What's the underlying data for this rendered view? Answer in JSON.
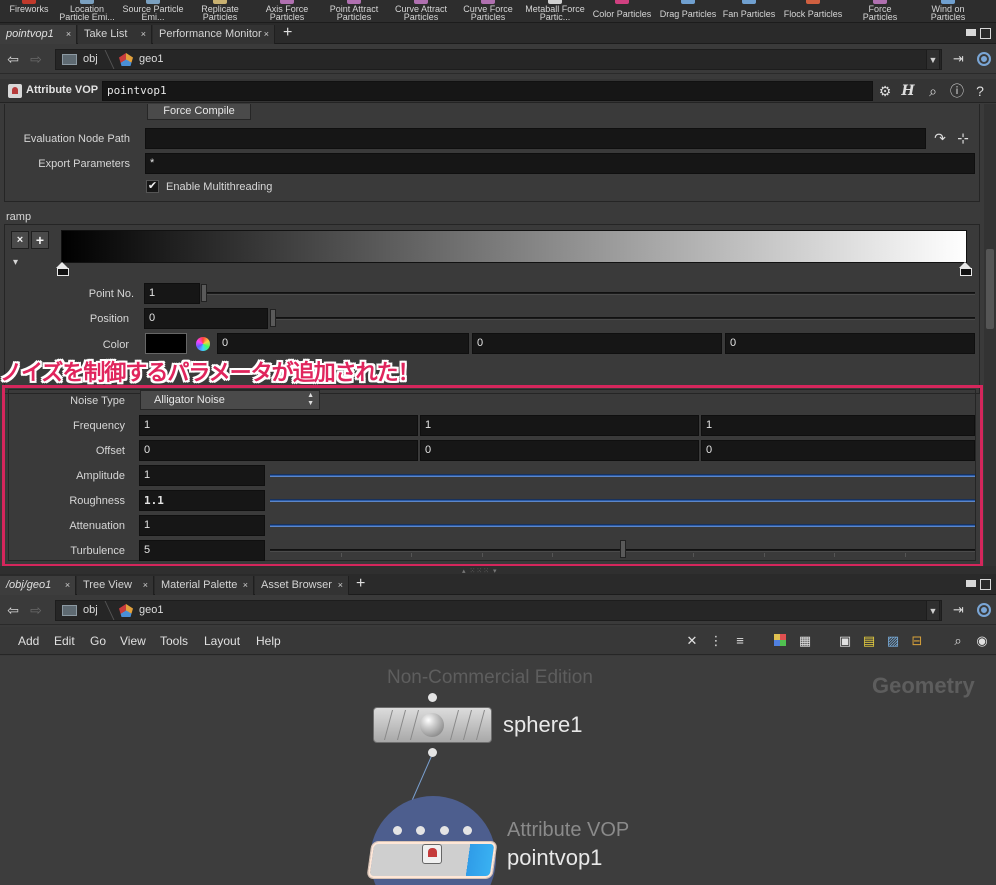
{
  "shelf": {
    "tools": [
      {
        "label": "Fireworks",
        "color": "#c0392b"
      },
      {
        "label": "Location Particle Emi...",
        "color": "#7aa0c0"
      },
      {
        "label": "Source Particle Emi...",
        "color": "#7aa0c0"
      },
      {
        "label": "Replicate Particles",
        "color": "#c8b070"
      },
      {
        "label": "Axis Force Particles",
        "color": "#b070b0"
      },
      {
        "label": "Point Attract Particles",
        "color": "#b070b0"
      },
      {
        "label": "Curve Attract Particles",
        "color": "#b070b0"
      },
      {
        "label": "Curve Force Particles",
        "color": "#b070b0"
      },
      {
        "label": "Metaball Force Partic...",
        "color": "#d0d0d0"
      },
      {
        "label": "Color Particles",
        "color": "#d04080"
      },
      {
        "label": "Drag Particles",
        "color": "#70a0d0"
      },
      {
        "label": "Fan Particles",
        "color": "#70a0d0"
      },
      {
        "label": "Flock Particles",
        "color": "#d06040"
      },
      {
        "label": "Force Particles",
        "color": "#b070b0"
      },
      {
        "label": "Wind on Particles",
        "color": "#70a0d0"
      }
    ]
  },
  "top_pane": {
    "tabs": [
      {
        "label": "pointvop1"
      },
      {
        "label": "Take List"
      },
      {
        "label": "Performance Monitor"
      }
    ],
    "close_glyph": "×",
    "plus_glyph": "+",
    "path": {
      "root": "obj",
      "node": "geo1"
    }
  },
  "params": {
    "node_type": "Attribute VOP",
    "node_name": "pointvop1",
    "force_compile_label": "Force Compile",
    "evaluation_node_path_label": "Evaluation Node Path",
    "evaluation_node_path_value": "",
    "export_parameters_label": "Export Parameters",
    "export_parameters_value": "*",
    "enable_multithreading_label": "Enable Multithreading",
    "enable_multithreading_checked": true,
    "check_glyph": "✔",
    "ramp_label": "ramp",
    "ramp_remove_glyph": "×",
    "ramp_add_glyph": "+",
    "ramp_menu_glyph": "▾",
    "point_no_label": "Point No.",
    "point_no_value": "1",
    "position_label": "Position",
    "position_value": "0",
    "color_label": "Color",
    "color_values": [
      "0",
      "0",
      "0"
    ],
    "noise_type_label": "Noise Type",
    "noise_type_value": "Alligator Noise",
    "frequency_label": "Frequency",
    "frequency_values": [
      "1",
      "1",
      "1"
    ],
    "offset_label": "Offset",
    "offset_values": [
      "0",
      "0",
      "0"
    ],
    "amplitude_label": "Amplitude",
    "amplitude_value": "1",
    "roughness_label": "Roughness",
    "roughness_value": "1.1",
    "attenuation_label": "Attenuation",
    "attenuation_value": "1",
    "turbulence_label": "Turbulence",
    "turbulence_value": "5",
    "turbulence_slider_fraction": 0.5
  },
  "annotation": {
    "text": "ノイズを制御するパラメータが追加された！",
    "color": "#e0255d"
  },
  "bottom_pane": {
    "tabs": [
      {
        "label": "/obj/geo1"
      },
      {
        "label": "Tree View"
      },
      {
        "label": "Material Palette"
      },
      {
        "label": "Asset Browser"
      }
    ],
    "path": {
      "root": "obj",
      "node": "geo1"
    },
    "menu": [
      "Add",
      "Edit",
      "Go",
      "View",
      "Tools",
      "Layout",
      "Help"
    ]
  },
  "network": {
    "watermark": "Non-Commercial Edition",
    "context_label": "Geometry",
    "nodes": [
      {
        "name": "sphere1",
        "type_label": ""
      },
      {
        "name": "pointvop1",
        "type_label": "Attribute VOP"
      }
    ]
  },
  "colors": {
    "accent_pink": "#d5265c",
    "slider_blue": "#2a5aa7",
    "vop_halo": "#4d5e8e",
    "vop_flag": "#39b1f2"
  }
}
